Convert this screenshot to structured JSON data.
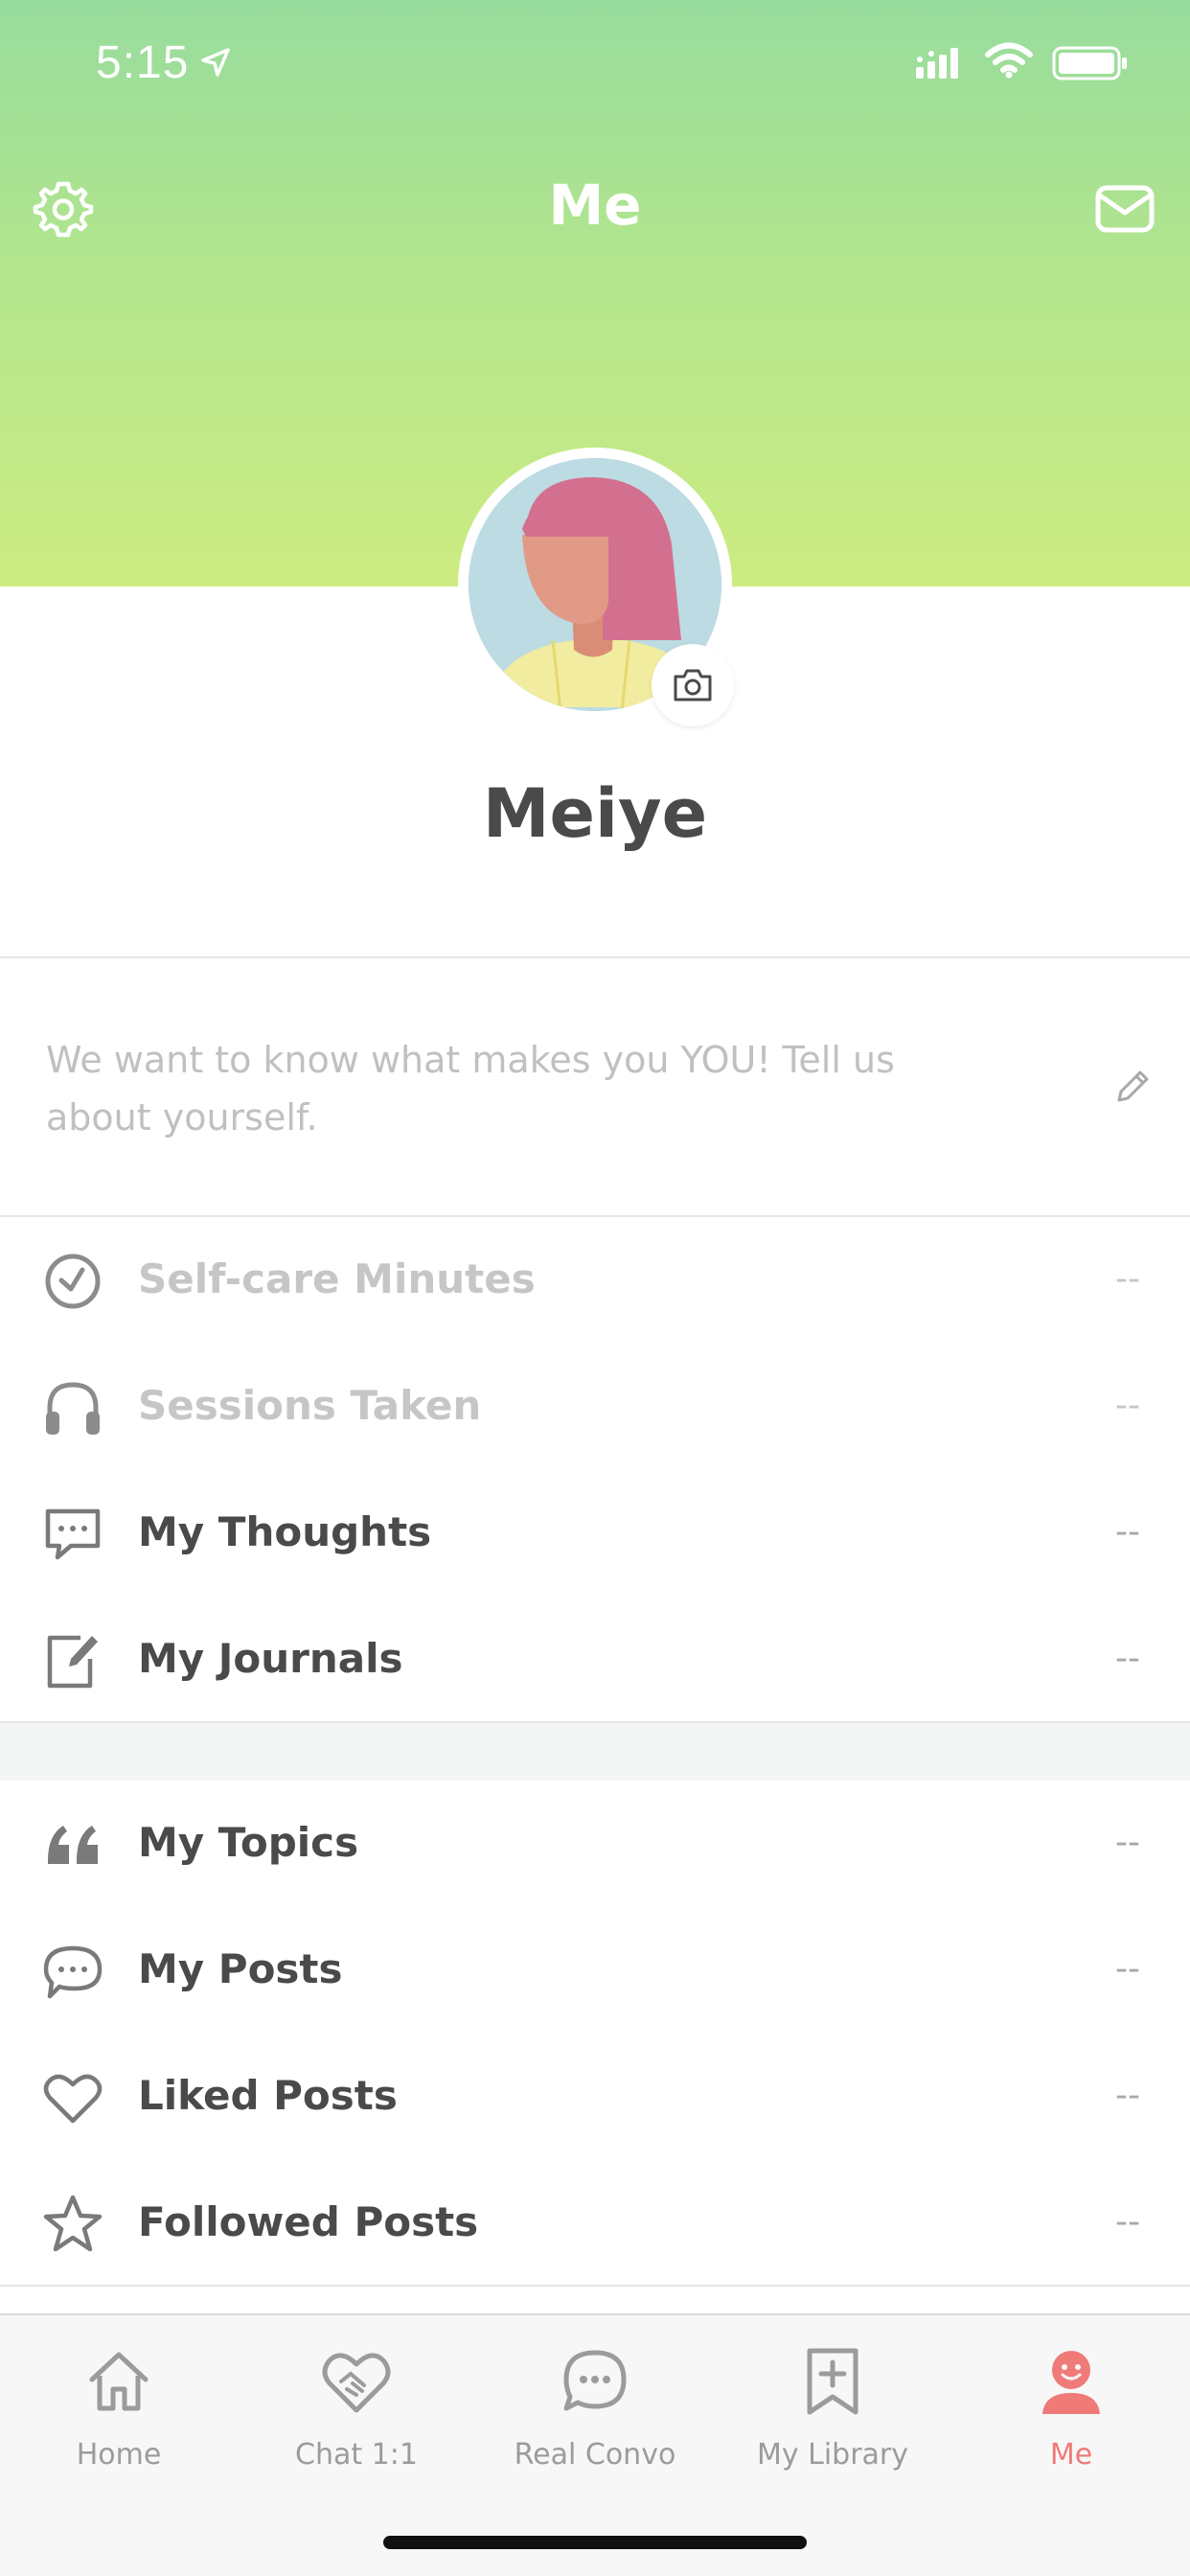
{
  "status_bar": {
    "time": "5:15"
  },
  "header": {
    "title": "Me"
  },
  "profile": {
    "name": "Meiye"
  },
  "bio": {
    "placeholder": "We want to know what makes you YOU! Tell us about yourself."
  },
  "stats": [
    {
      "label": "Self-care Minutes",
      "value": "--",
      "icon": "clock-icon"
    },
    {
      "label": "Sessions Taken",
      "value": "--",
      "icon": "headphones-icon"
    },
    {
      "label": "My Thoughts",
      "value": "--",
      "icon": "chat-bubble-icon"
    },
    {
      "label": "My Journals",
      "value": "--",
      "icon": "journal-edit-icon"
    }
  ],
  "community": [
    {
      "label": "My Topics",
      "value": "--",
      "icon": "quote-icon"
    },
    {
      "label": "My Posts",
      "value": "--",
      "icon": "speech-bubble-icon"
    },
    {
      "label": "Liked Posts",
      "value": "--",
      "icon": "heart-icon"
    },
    {
      "label": "Followed Posts",
      "value": "--",
      "icon": "star-icon"
    }
  ],
  "tab_bar": {
    "tabs": [
      {
        "label": "Home",
        "icon": "home-icon"
      },
      {
        "label": "Chat 1:1",
        "icon": "handshake-heart-icon"
      },
      {
        "label": "Real Convo",
        "icon": "chat-circle-icon"
      },
      {
        "label": "My Library",
        "icon": "bookmark-plus-icon"
      },
      {
        "label": "Me",
        "icon": "smiley-person-icon"
      }
    ],
    "active": "Me"
  },
  "colors": {
    "header_gradient_top": "#97dc9d",
    "header_gradient_bottom": "#cdec82",
    "active_tab": "#f07a78",
    "text_dark": "#4a4a4a",
    "text_muted": "#c6c6c6"
  }
}
